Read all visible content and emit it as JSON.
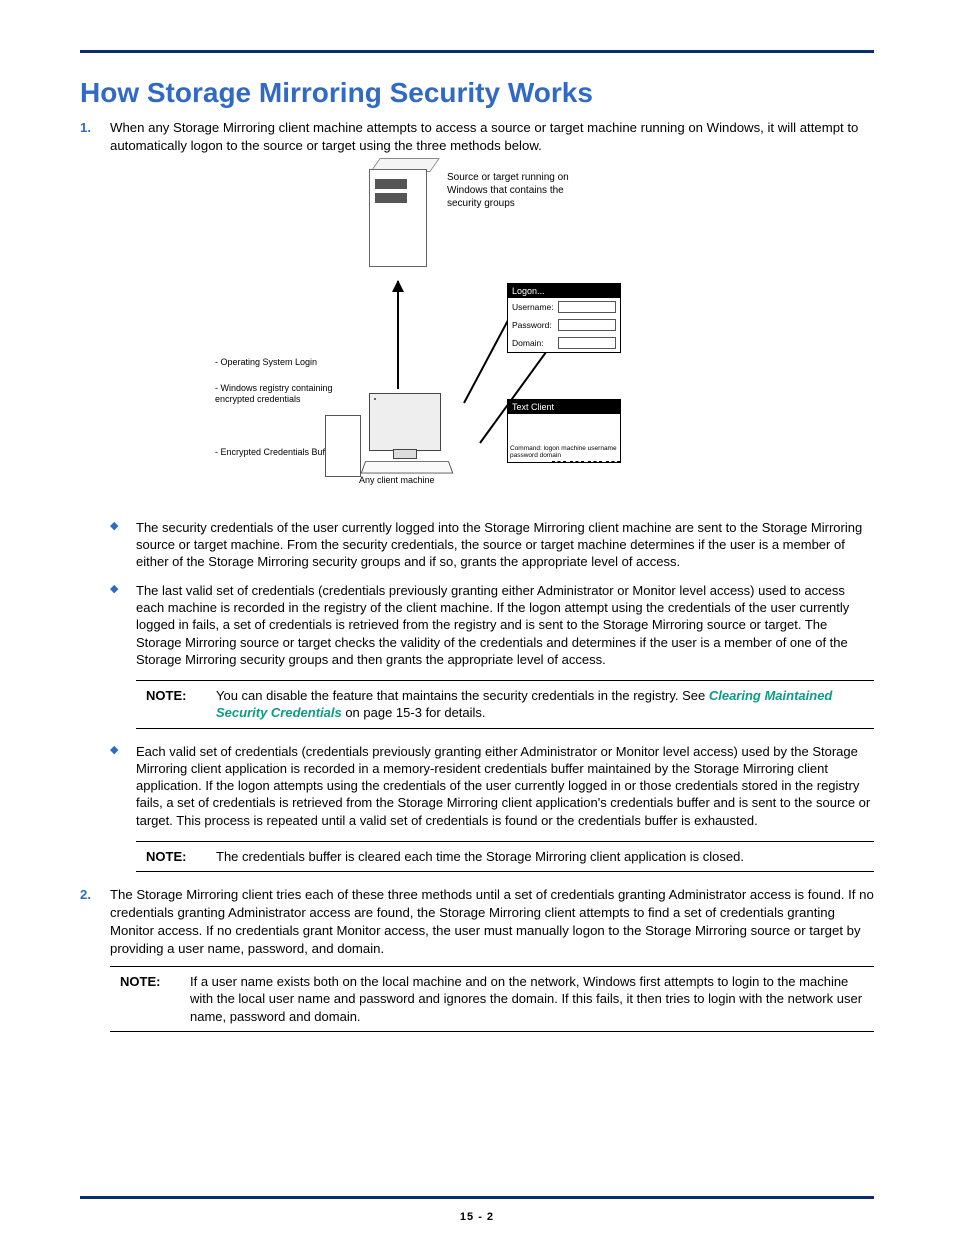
{
  "title": "How Storage Mirroring Security Works",
  "step1": {
    "num": "1.",
    "text": "When any Storage Mirroring client machine attempts to access a source or target machine running on Windows, it will attempt to automatically logon to the source or target using the three methods below."
  },
  "diagram": {
    "server_caption": "Source or target running on Windows that contains the security groups",
    "methods": {
      "a": "Operating System Login",
      "b": "Windows registry containing encrypted credentials",
      "c": "Encrypted Credentials Buffer"
    },
    "client_caption": "Any client machine",
    "logon": {
      "title": "Logon...",
      "u": "Username:",
      "p": "Password:",
      "d": "Domain:"
    },
    "textclient": {
      "title": "Text Client",
      "cmd": "Command: logon machine username password domain"
    }
  },
  "bullets": [
    "The security credentials of the user currently logged into the Storage Mirroring client machine are sent to the Storage Mirroring source or target machine. From the security credentials, the source or target machine determines if the user is a member of either of the Storage Mirroring security groups and if so, grants the appropriate level of access.",
    "The last valid set of credentials (credentials previously granting either Administrator or Monitor level access) used to access each machine is recorded in the registry of the client machine.  If the logon attempt using the credentials of the user currently logged in fails, a set of credentials is retrieved from the registry and is sent to the Storage Mirroring source or target.  The Storage Mirroring source or target checks the validity of the credentials and determines if the user is a member of one of the Storage Mirroring security groups and then grants the appropriate level of access.",
    "Each valid set of credentials (credentials previously granting either Administrator or Monitor level access) used by the Storage Mirroring client application is recorded in a memory-resident credentials buffer maintained by the Storage Mirroring client application. If the logon attempts using the credentials of the user currently logged in or those credentials stored in the registry fails, a set of credentials is retrieved from the Storage Mirroring client application's credentials buffer and is sent to the source or target.  This process is repeated until a valid set of credentials is found or the credentials buffer is exhausted."
  ],
  "note1": {
    "label": "NOTE:",
    "pre": "You can disable the feature that maintains the security credentials in the registry. See ",
    "link": "Clearing Maintained Security Credentials",
    "post": " on page 15-3 for details."
  },
  "note2": {
    "label": "NOTE:",
    "text": "The credentials buffer is cleared each time the Storage Mirroring client application is closed."
  },
  "step2": {
    "num": "2.",
    "text": "The Storage Mirroring client tries each of these three methods until a set of credentials granting Administrator access is found. If no credentials granting Administrator access are found, the Storage Mirroring client attempts to find a set of credentials granting Monitor access.  If no credentials grant Monitor access, the user must manually logon to the Storage Mirroring source or target by providing a user name, password, and domain."
  },
  "note3": {
    "label": "NOTE:",
    "text": "If a user name exists both on the local machine and on the network, Windows first attempts to login to the machine with the local user name and password and ignores the domain.  If this fails, it then tries to login with the network user name, password and domain."
  },
  "footer": "15 - 2"
}
